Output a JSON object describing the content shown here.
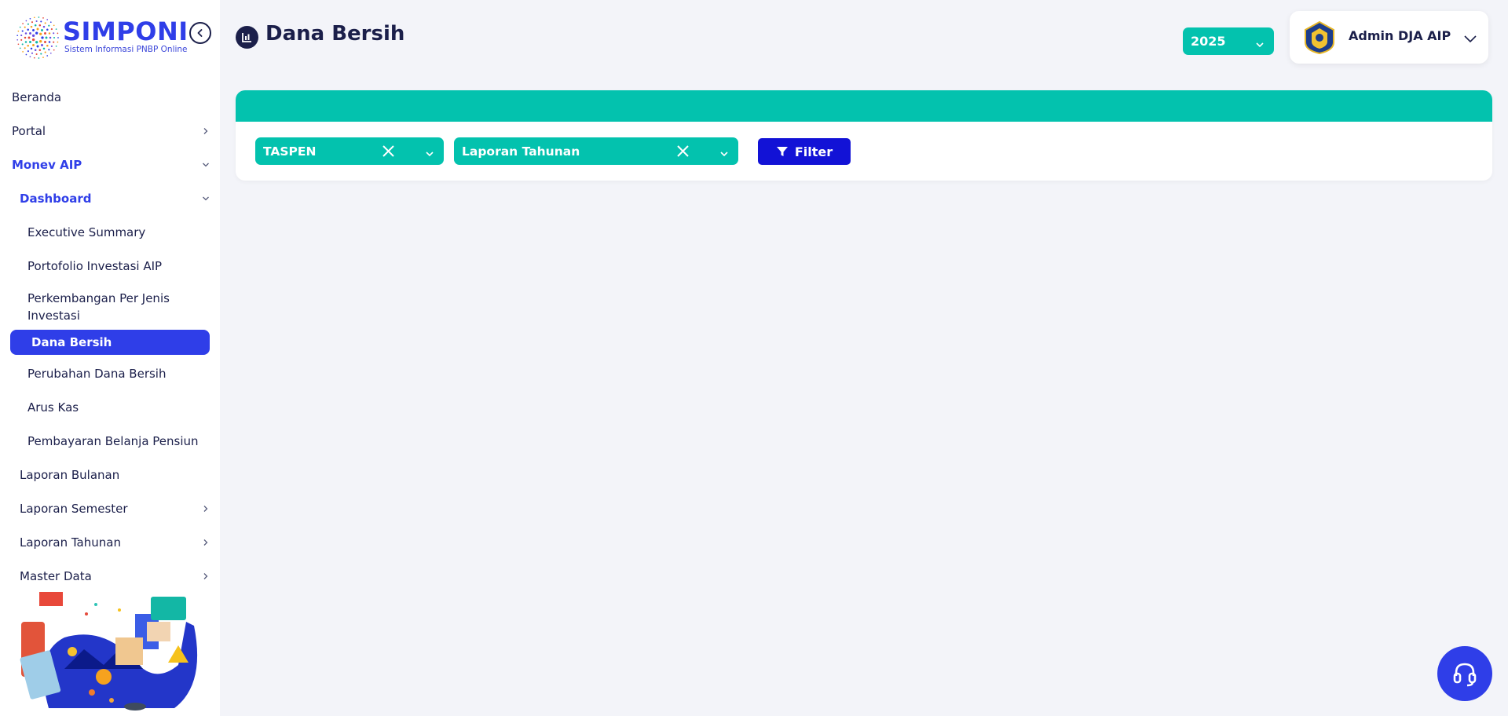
{
  "brand": {
    "name": "SIMPONI",
    "tagline": "Sistem Informasi PNBP Online",
    "color": "#2f3ee8"
  },
  "sidebar": {
    "collapse_icon": "chevron-left-circle-icon",
    "items": [
      {
        "label": "Beranda",
        "level": 1
      },
      {
        "label": "Portal",
        "level": 1,
        "has_children": true
      },
      {
        "label": "Monev AIP",
        "level": 1,
        "expanded": true
      },
      {
        "label": "Dashboard",
        "level": 2,
        "expanded": true
      },
      {
        "label": "Executive Summary",
        "level": 3
      },
      {
        "label": "Portofolio Investasi AIP",
        "level": 3
      },
      {
        "label": "Perkembangan Per Jenis Investasi",
        "level": 3
      },
      {
        "label": "Dana Bersih",
        "level": 3,
        "selected": true
      },
      {
        "label": "Perubahan Dana Bersih",
        "level": 3
      },
      {
        "label": "Arus Kas",
        "level": 3
      },
      {
        "label": "Pembayaran Belanja Pensiun",
        "level": 3
      },
      {
        "label": "Laporan Bulanan",
        "level": 2
      },
      {
        "label": "Laporan Semester",
        "level": 2,
        "has_children": true
      },
      {
        "label": "Laporan Tahunan",
        "level": 2,
        "has_children": true
      },
      {
        "label": "Master Data",
        "level": 2,
        "has_children": true
      }
    ]
  },
  "header": {
    "title": "Dana Bersih",
    "title_icon": "chart-icon",
    "year": "2025",
    "user_name": "Admin DJA AIP",
    "user_emblem": "kemenkeu-emblem-icon"
  },
  "filters": {
    "entity": "TASPEN",
    "report_type": "Laporan Tahunan",
    "filter_label": "Filter",
    "accent": "#03c2ae",
    "button_color": "#1212d6"
  },
  "help": {
    "icon": "headset-icon"
  }
}
